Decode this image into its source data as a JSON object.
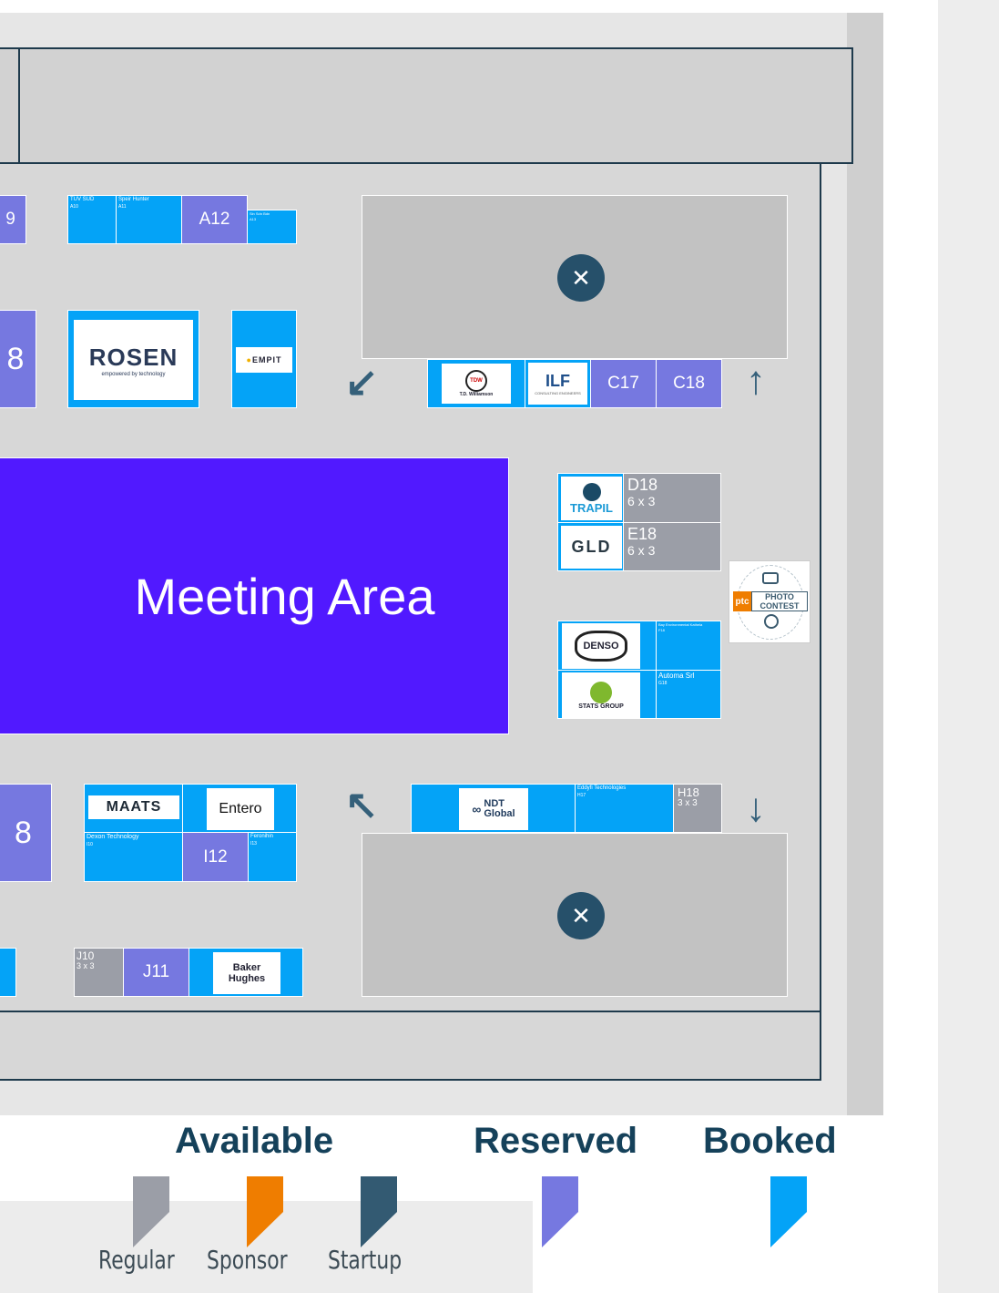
{
  "hall": {
    "meeting_area_label": "Meeting Area"
  },
  "booths": {
    "a9_label": "9",
    "a10_name": "TUV SUD",
    "a10_id": "A10",
    "a11_name": "Speir Hunter",
    "a11_id": "A11",
    "a12_label": "A12",
    "a13_name": "Sin Sdn Bdn",
    "a13_id": "A13",
    "b_left_label": "8",
    "c17_label": "C17",
    "c18_label": "C18",
    "d18_label": "D18",
    "d18_size": "6 x 3",
    "e18_label": "E18",
    "e18_size": "6 x 3",
    "f18_name": "Bay Environmental Kathela",
    "f18_id": "F18",
    "g18_name": "Automa Srl",
    "g18_id": "G18",
    "h17_name": "Eddyfi Technologies",
    "h17_id": "H17",
    "h18_label": "H18",
    "h18_size": "3 x 3",
    "i_left_label": "8",
    "i10_name": "Dexon Technology",
    "i10_id": "I10",
    "i12_label": "I12",
    "i13_name": "Feronihin",
    "i13_id": "I13",
    "j10_label": "J10",
    "j10_size": "3 x 3",
    "j11_label": "J11"
  },
  "logos": {
    "rosen": "ROSEN",
    "rosen_tagline": "empowered by technology",
    "empit": "EMPIT",
    "tdw": "T.D. Williamson",
    "ilf": "ILF",
    "ilf_sub": "CONSULTING ENGINEERS",
    "trapil": "TRAPIL",
    "gld": "GLD",
    "photo_contest_line1": "PHOTO",
    "photo_contest_line2": "CONTEST",
    "photo_contest_badge": "ptc",
    "denso": "DENSO",
    "stats": "STATS GROUP",
    "maats": "MAATS",
    "entero": "Entero",
    "ndt_line1": "NDT",
    "ndt_line2": "Global",
    "baker_line1": "Baker",
    "baker_line2": "Hughes"
  },
  "icons": {
    "food": "fork-spoon-icon",
    "arrow_down_left": "↙",
    "arrow_up": "↑",
    "arrow_up_left": "↖",
    "arrow_down": "↓",
    "food_glyph": "✕"
  },
  "legend": {
    "available_title": "Available",
    "reserved_title": "Reserved",
    "booked_title": "Booked",
    "regular_label": "Regular",
    "sponsor_label": "Sponsor",
    "startup_label": "Startup"
  },
  "colors": {
    "regular": "#9b9ea7",
    "sponsor": "#ef7d00",
    "startup": "#335a72",
    "reserved": "#7678e0",
    "booked": "#04a3f7",
    "meeting": "#5119ff"
  }
}
